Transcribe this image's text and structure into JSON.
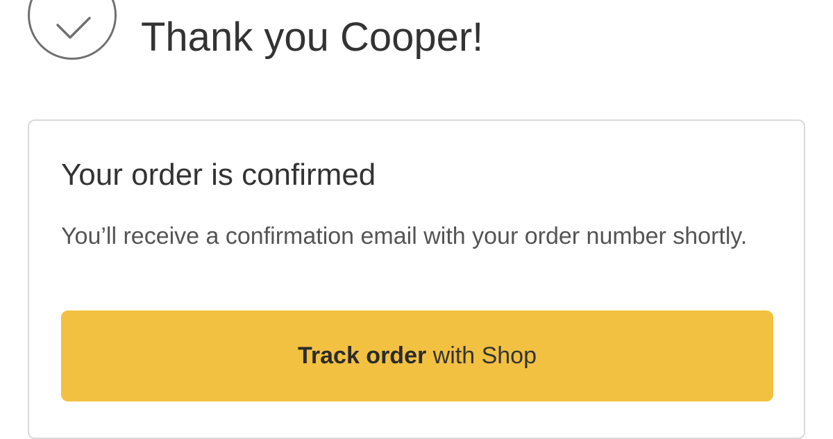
{
  "header": {
    "icon": "check-circle-icon",
    "title": "Thank you Cooper!"
  },
  "card": {
    "title": "Your order is confirmed",
    "body": "You’ll receive a confirmation email with your order number shortly.",
    "button": {
      "label_bold": "Track order",
      "label_regular": "with Shop",
      "color": "#f2c141"
    }
  },
  "colors": {
    "text": "#333333",
    "border": "#d9d9d9",
    "icon": "#707070"
  }
}
